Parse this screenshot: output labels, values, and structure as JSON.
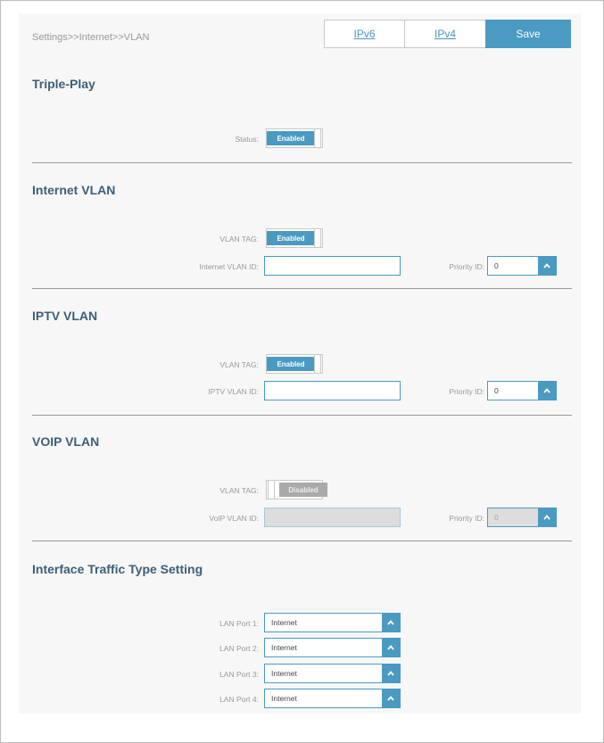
{
  "breadcrumb": "Settings>>Internet>>VLAN",
  "header": {
    "ipv6_label": "IPv6",
    "ipv4_label": "IPv4",
    "save_label": "Save"
  },
  "triple_play": {
    "title": "Triple-Play",
    "status_label": "Status:",
    "status_value": "Enabled"
  },
  "internet_vlan": {
    "title": "Internet VLAN",
    "tag_label": "VLAN TAG:",
    "tag_value": "Enabled",
    "id_label": "Internet VLAN ID:",
    "id_value": "",
    "priority_label": "Priority ID:",
    "priority_value": "0"
  },
  "iptv_vlan": {
    "title": "IPTV VLAN",
    "tag_label": "VLAN TAG:",
    "tag_value": "Enabled",
    "id_label": "IPTV VLAN ID:",
    "id_value": "",
    "priority_label": "Priority ID:",
    "priority_value": "0"
  },
  "voip_vlan": {
    "title": "VOIP VLAN",
    "tag_label": "VLAN TAG:",
    "tag_value": "Disabled",
    "id_label": "VoIP VLAN ID:",
    "id_value": "",
    "priority_label": "Priority ID:",
    "priority_value": "0"
  },
  "traffic": {
    "title": "Interface Traffic Type Setting",
    "ports": [
      {
        "label": "LAN Port 1:",
        "value": "Internet"
      },
      {
        "label": "LAN Port 2:",
        "value": "Internet"
      },
      {
        "label": "LAN Port 3:",
        "value": "Internet"
      },
      {
        "label": "LAN Port 4:",
        "value": "Internet"
      }
    ]
  },
  "colors": {
    "accent": "#4a9ac2",
    "title": "#3c5f78",
    "disabled": "#aaaaaa"
  },
  "icons": {
    "caret": "chevron-up-icon"
  }
}
